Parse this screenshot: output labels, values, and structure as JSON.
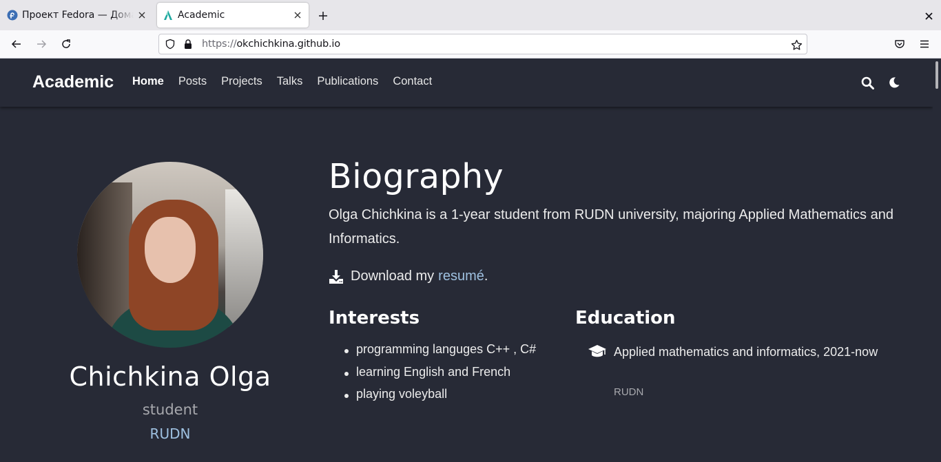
{
  "browser": {
    "tabs": [
      {
        "title": "Проект Fedora — Домашняя страница",
        "active": false,
        "icon": "fedora-icon"
      },
      {
        "title": "Academic",
        "active": true,
        "icon": "academic-icon"
      }
    ],
    "url": {
      "scheme": "https://",
      "host": "okchichkina.github.io"
    }
  },
  "site": {
    "brand": "Academic",
    "nav": [
      "Home",
      "Posts",
      "Projects",
      "Talks",
      "Publications",
      "Contact"
    ],
    "active_nav": "Home"
  },
  "profile": {
    "name": "Chichkina Olga",
    "role": "student",
    "organization": "RUDN"
  },
  "biography": {
    "title": "Biography",
    "text": "Olga Chichkina is a 1-year student from RUDN university, majoring Applied Mathematics and Informatics.",
    "download_prefix": "Download my",
    "download_link": "resumé",
    "download_suffix": "."
  },
  "interests": {
    "title": "Interests",
    "items": [
      "programming languges C++ , C#",
      "learning English and French",
      "playing voleyball"
    ]
  },
  "education": {
    "title": "Education",
    "course": "Applied mathematics and informatics, 2021-now",
    "institution": "RUDN"
  },
  "colors": {
    "page_bg": "#272a36",
    "link": "#9ec0e0",
    "text": "#ececec"
  }
}
